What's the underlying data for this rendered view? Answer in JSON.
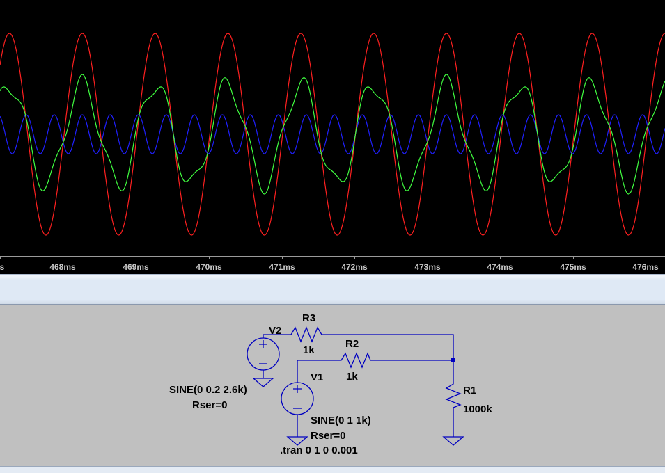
{
  "waveform_viewer": {
    "x_ticks": [
      "s",
      "468ms",
      "469ms",
      "470ms",
      "471ms",
      "472ms",
      "473ms",
      "474ms",
      "475ms",
      "476ms"
    ],
    "trace_colors": {
      "sum": "#ff2020",
      "mix": "#40ff40",
      "hf": "#2020ff"
    },
    "background": "#000000"
  },
  "schematic": {
    "components": {
      "v2_name": "V2",
      "v2_value": "SINE(0 0.2 2.6k)",
      "v2_rser": "Rser=0",
      "v1_name": "V1",
      "v1_value": "SINE(0 1 1k)",
      "v1_rser": "Rser=0",
      "r3_name": "R3",
      "r3_value": "1k",
      "r2_name": "R2",
      "r2_value": "1k",
      "r1_name": "R1",
      "r1_value": "1000k"
    },
    "directive": ".tran 0 1 0 0.001",
    "wire_color": "#0000c0"
  }
}
